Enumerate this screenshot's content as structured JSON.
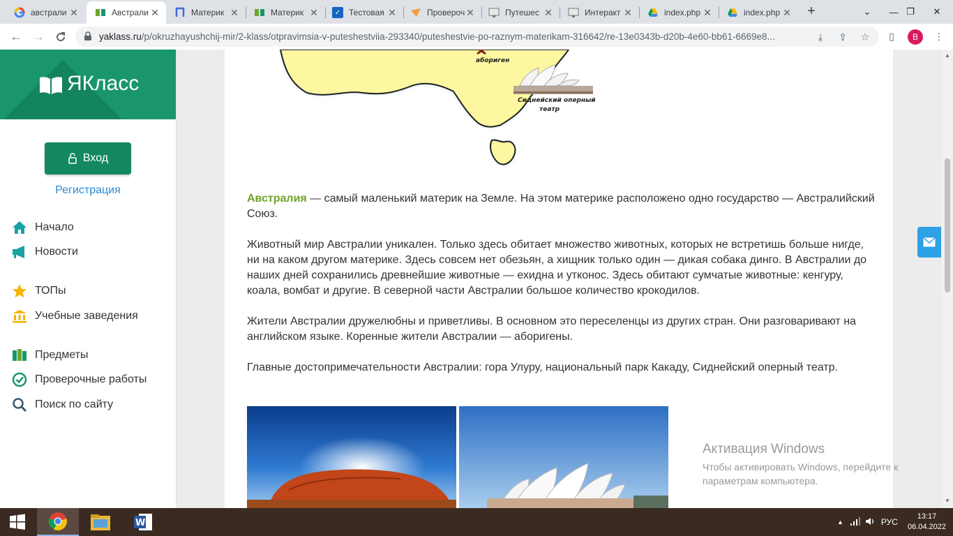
{
  "browser": {
    "tabs": [
      {
        "title": "австрали",
        "favicon": "google-icon",
        "active": false
      },
      {
        "title": "Австрали",
        "favicon": "yaklass-icon",
        "active": true
      },
      {
        "title": "Материк",
        "favicon": "p-icon",
        "active": false
      },
      {
        "title": "Материк",
        "favicon": "yaklass-icon",
        "active": false
      },
      {
        "title": "Тестовая",
        "favicon": "check-icon",
        "active": false
      },
      {
        "title": "Провероч",
        "favicon": "paper-plane-icon",
        "active": false
      },
      {
        "title": "Путешес",
        "favicon": "monitor-icon",
        "active": false
      },
      {
        "title": "Интеракт",
        "favicon": "monitor-icon",
        "active": false
      },
      {
        "title": "index.php",
        "favicon": "drive-icon",
        "active": false
      },
      {
        "title": "index.php",
        "favicon": "drive-icon",
        "active": false
      }
    ],
    "new_tab": "+",
    "url_host": "yaklass.ru",
    "url_path": "/p/okruzhayushchij-mir/2-klass/otpravimsia-v-puteshestviia-293340/puteshestvie-po-raznym-materikam-316642/re-13e0343b-d20b-4e60-bb61-6669e8...",
    "profile_initial": "B"
  },
  "sidebar": {
    "logo_text": "ЯКласс",
    "login_label": "Вход",
    "register_label": "Регистрация",
    "nav": [
      {
        "label": "Начало",
        "icon": "home-icon"
      },
      {
        "label": "Новости",
        "icon": "megaphone-icon"
      },
      {
        "label": "ТОПы",
        "icon": "star-icon"
      },
      {
        "label": "Учебные заведения",
        "icon": "institution-icon"
      },
      {
        "label": "Предметы",
        "icon": "books-icon"
      },
      {
        "label": "Проверочные работы",
        "icon": "check-circle-icon"
      },
      {
        "label": "Поиск по сайту",
        "icon": "search-icon"
      }
    ]
  },
  "map": {
    "label_aborigine": "абориген",
    "label_opera_line1": "Сиднейский оперный",
    "label_opera_line2": "театр"
  },
  "article": {
    "p1_highlight": "Австралия",
    "p1_rest": " — самый маленький материк на Земле. На этом материке расположено одно государство — Австралийский Союз.",
    "p2": "Животный мир Австралии уникален. Только здесь обитает множество животных, которых не встретишь больше нигде, ни на каком другом материке. Здесь совсем нет обезьян, а хищник только один — дикая собака динго. В Австралии до наших дней сохранились древнейшие животные — ехидна и утконос. Здесь обитают сумчатые животные: кенгуру, коала, вомбат и другие. В северной части Австралии большое количество крокодилов.",
    "p3": "Жители Австралии дружелюбны и приветливы. В основном это переселенцы из других стран. Они разговаривают на английском языке. Коренные жители Австралии — аборигены.",
    "p4": "Главные достопримечательности Австралии: гора Улуру, национальный парк Какаду, Сиднейский оперный театр."
  },
  "watermark": {
    "title": "Активация Windows",
    "line1": "Чтобы активировать Windows, перейдите к",
    "line2": "параметрам компьютера."
  },
  "taskbar": {
    "lang": "РУС",
    "time": "13:17",
    "date": "06.04.2022"
  },
  "colors": {
    "brand": "#19966d",
    "highlight": "#6ea52b",
    "link": "#2b8bd6"
  }
}
